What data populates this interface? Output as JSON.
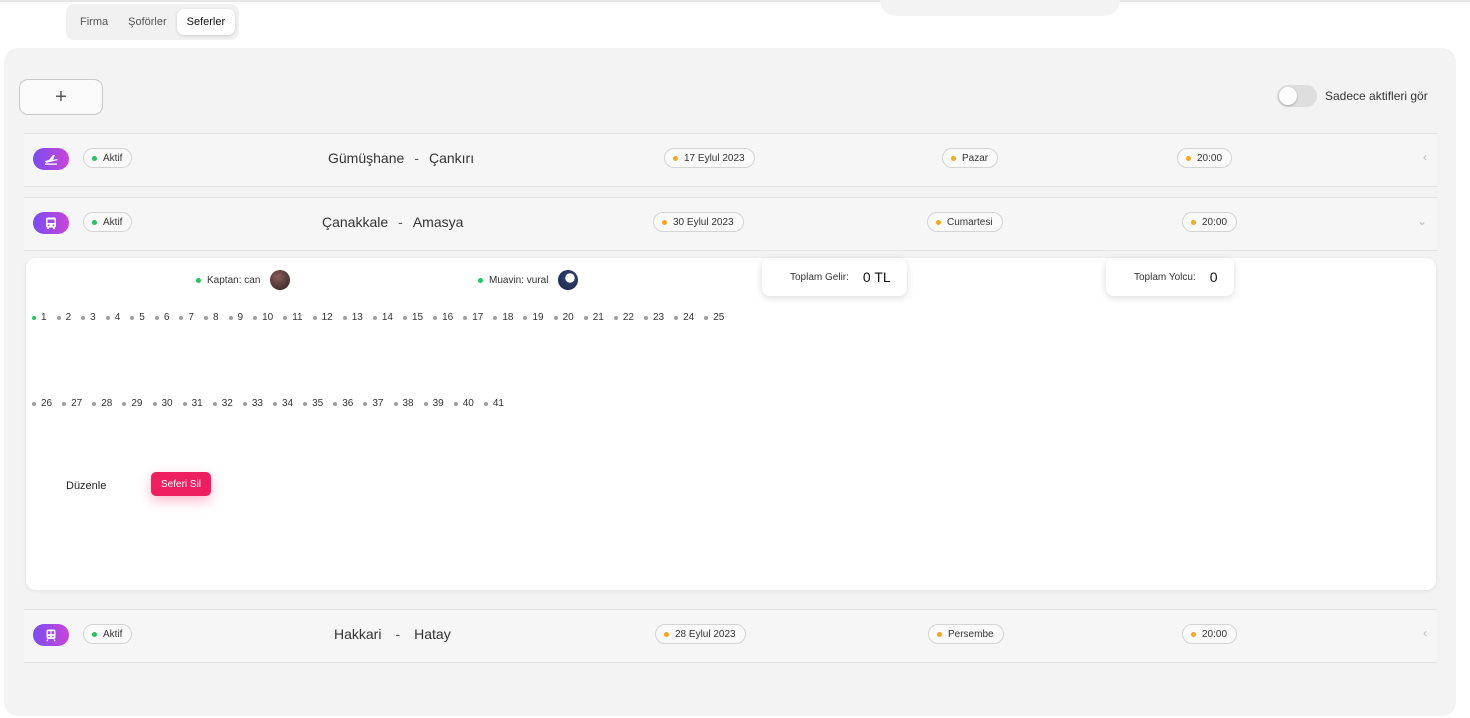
{
  "tabs": [
    "Firma",
    "Şoförler",
    "Seferler"
  ],
  "active_tab": "Seferler",
  "toolbar": {
    "add_label": "+",
    "active_only_label": "Sadece aktifleri gör",
    "active_only_on": false
  },
  "trips": [
    {
      "status": "Aktif",
      "vehicle_icon": "plane-icon",
      "from": "Gümüşhane",
      "to": "Çankırı",
      "date": "17 Eylul 2023",
      "day": "Pazar",
      "time": "20:00",
      "chevron": "‹"
    },
    {
      "status": "Aktif",
      "vehicle_icon": "bus-icon",
      "from": "Çanakkale",
      "to": "Amasya",
      "date": "30 Eylul 2023",
      "day": "Cumartesi",
      "time": "20:00",
      "chevron": "⌄"
    },
    {
      "status": "Aktif",
      "vehicle_icon": "train-icon",
      "from": "Hakkari",
      "to": "Hatay",
      "date": "28 Eylul 2023",
      "day": "Persembe",
      "time": "20:00",
      "chevron": "‹"
    }
  ],
  "route_separator": "-",
  "detail": {
    "captain_label": "Kaptan: can",
    "assistant_label": "Muavin: vural",
    "total_income_label": "Toplam Gelir:",
    "total_income_value": "0 TL",
    "total_passengers_label": "Toplam Yolcu:",
    "total_passengers_value": "0",
    "seats_row1": [
      "1",
      "2",
      "3",
      "4",
      "5",
      "6",
      "7",
      "8",
      "9",
      "10",
      "11",
      "12",
      "13",
      "14",
      "15",
      "16",
      "17",
      "18",
      "19",
      "20",
      "21",
      "22",
      "23",
      "24",
      "25"
    ],
    "seats_row2": [
      "26",
      "27",
      "28",
      "29",
      "30",
      "31",
      "32",
      "33",
      "34",
      "35",
      "36",
      "37",
      "38",
      "39",
      "40",
      "41"
    ],
    "highlighted_seat": "1",
    "edit_label": "Düzenle",
    "delete_label": "Seferi Sil"
  },
  "colors": {
    "accent_gradient_start": "#7b4df0",
    "accent_gradient_end": "#c845d8",
    "active_dot": "#22c55e",
    "info_dot": "#f5a623",
    "danger": "#ed1f5f"
  }
}
